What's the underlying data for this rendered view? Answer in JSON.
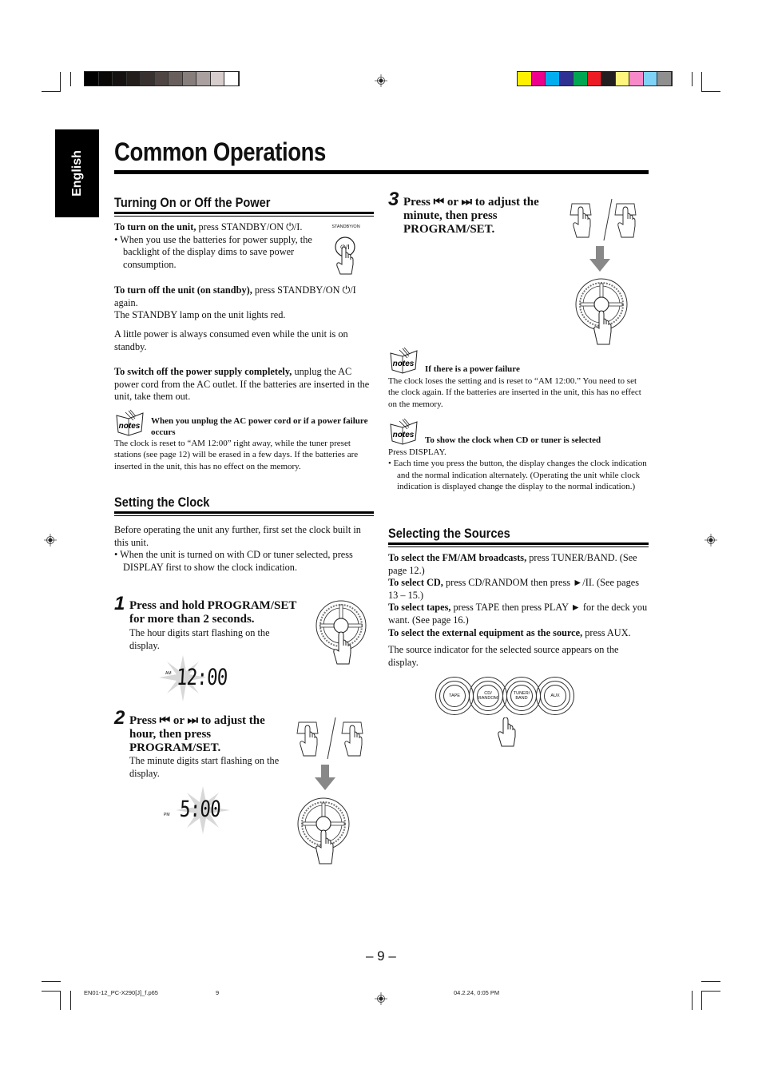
{
  "print_marks": {
    "grayscale_swatches": [
      "#000000",
      "#0a0807",
      "#151110",
      "#231d1b",
      "#393130",
      "#4f4644",
      "#685f5d",
      "#877e7c",
      "#a9a09f",
      "#d6cdcc",
      "#ffffff"
    ],
    "color_swatches": [
      "#fff000",
      "#ec008c",
      "#00aeef",
      "#2e3192",
      "#00a651",
      "#ed1c24",
      "#231f20",
      "#fff57d",
      "#f789c9",
      "#7fd3f7",
      "#8f8f8f"
    ]
  },
  "language_tab": "English",
  "page_title": "Common Operations",
  "power": {
    "heading": "Turning On or Off the Power",
    "turn_on_bold": "To turn on the unit,",
    "turn_on_text": " press STANDBY/ON ⏻/I.",
    "turn_on_bullet": "When you use the batteries for power supply, the backlight of the display dims to save power consumption.",
    "button_label": "STANDBY/ON",
    "button_glyph": "⏻/I",
    "turn_off_bold": "To turn off the unit (on standby),",
    "turn_off_text": " press STANDBY/ON ⏻/I again.",
    "lamp_text": "The STANDBY lamp on the unit lights red.",
    "standby_text": "A little power is always consumed even while the unit is on standby.",
    "switch_off_bold": "To switch off the power supply completely,",
    "switch_off_text": " unplug the AC power cord from the AC outlet. If the batteries are inserted in the unit, take them out.",
    "note_heading": "When you unplug the AC power cord or if a power failure occurs",
    "note_text": "The clock is reset to “AM 12:00” right away, while the tuner preset stations (see page 12) will be erased in a few days. If the batteries are inserted in the unit, this has no effect on the memory."
  },
  "notes_icon_label": "notes",
  "clock": {
    "heading": "Setting the Clock",
    "intro": "Before operating the unit any further, first set the clock built in this unit.",
    "bullet": "When the unit is turned on with CD or tuner selected, press DISPLAY first to show the clock indication.",
    "steps": [
      {
        "number": "1",
        "heading": "Press and hold PROGRAM/SET for more than 2 seconds.",
        "body": "The hour digits start flashing on the display.",
        "display": "12:00",
        "display_indicator": "AM"
      },
      {
        "number": "2",
        "heading": "Press ⏮ or ⏭ to adjust the hour, then press PROGRAM/SET.",
        "body": "The minute digits start flashing on the display.",
        "display": "5:00",
        "display_indicator": "PM"
      },
      {
        "number": "3",
        "heading": "Press ⏮ or ⏭ to adjust the minute, then press PROGRAM/SET."
      }
    ],
    "prev_button_glyph": "⏮",
    "next_button_glyph": "⏭",
    "note1_heading": "If there is a power failure",
    "note1_text": "The clock loses the setting and is reset to “AM 12:00.” You need to set the clock again. If the batteries are inserted in the unit, this has no effect on the memory.",
    "note2_heading": "To show the clock when CD or tuner is selected",
    "note2_text": "Press DISPLAY.",
    "note2_bullet": "Each time you press the button, the display changes the clock indication and the normal indication alternately. (Operating the unit while clock indication is displayed change the display to the normal indication.)"
  },
  "sources": {
    "heading": "Selecting the Sources",
    "items": [
      {
        "bold": "To select the FM/AM broadcasts,",
        "text": " press TUNER/BAND. (See page 12.)"
      },
      {
        "bold": "To select CD,",
        "text": " press CD/RANDOM then press ►/II. (See pages 13 – 15.)"
      },
      {
        "bold": "To select tapes,",
        "text": " press TAPE then press PLAY ► for the deck you want. (See page 16.)"
      },
      {
        "bold": "To select the external equipment as the source,",
        "text": " press AUX."
      }
    ],
    "indicator_text": "The source indicator for the selected source appears on the display.",
    "buttons": [
      {
        "line1": "TAPE",
        "line2": ""
      },
      {
        "line1": "CD/",
        "line2": "RANDOM"
      },
      {
        "line1": "TUNER/",
        "line2": "BAND"
      },
      {
        "line1": "AUX",
        "line2": ""
      }
    ]
  },
  "page_number": "– 9 –",
  "footer": {
    "file": "EN01-12_PC-X290[J]_f.p65",
    "page": "9",
    "timestamp": "04.2.24, 0:05 PM"
  }
}
